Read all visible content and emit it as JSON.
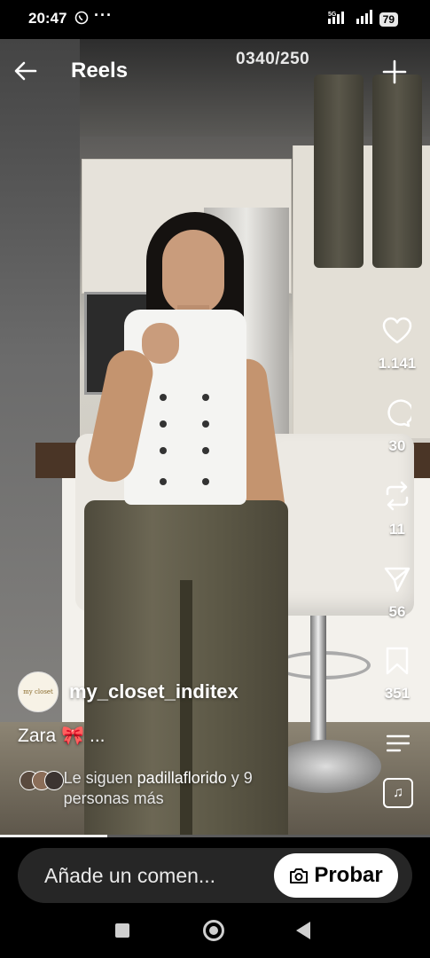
{
  "status_bar": {
    "time": "20:47",
    "more": "···",
    "network": "5G",
    "battery": "79"
  },
  "header": {
    "title": "Reels",
    "video_counter": "0340/250"
  },
  "actions": {
    "likes": "1.141",
    "comments": "30",
    "reposts": "11",
    "shares": "56",
    "saves": "351"
  },
  "post": {
    "username": "my_closet_inditex",
    "avatar_text": "my closet",
    "caption": "Zara 🎀 ...",
    "followers_prefix": "Le siguen ",
    "followers_name": "padillaflorido",
    "followers_suffix": " y 9 personas más"
  },
  "progress": {
    "fraction": 0.25
  },
  "comment_bar": {
    "placeholder": "Añade un comen...",
    "try_button": "Probar"
  }
}
